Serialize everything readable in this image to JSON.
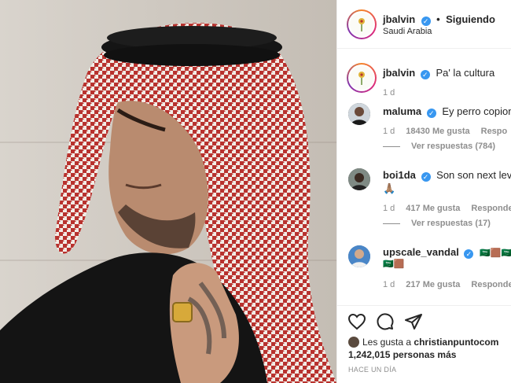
{
  "post": {
    "author": "jbalvin",
    "follow_status": "Siguiendo",
    "location": "Saudi Arabia",
    "caption": "Pa' la cultura",
    "caption_age": "1 d"
  },
  "comments": [
    {
      "user": "maluma",
      "text": "Ey perro copion",
      "age": "1 d",
      "likes": "18430 Me gusta",
      "reply": "Respo",
      "replies": "Ver respuestas (784)"
    },
    {
      "user": "boi1da",
      "text": "Son son next level",
      "text2": "🙏🏽",
      "age": "1 d",
      "likes": "417 Me gusta",
      "reply": "Responde",
      "replies": "Ver respuestas (17)"
    },
    {
      "user": "upscale_vandal",
      "text": "🇸🇦🟫🇸🇦🟫",
      "text2": "🇸🇦🟫",
      "age": "1 d",
      "likes": "217 Me gusta",
      "reply": "Responde"
    }
  ],
  "footer": {
    "likes_prefix": "Les gusta a",
    "liker": "christianpuntocom",
    "likes_count": "1,242,015 personas más",
    "timestamp": "HACE UN DÍA"
  },
  "icons": {
    "verified": "verified-badge-icon",
    "like": "heart-icon",
    "comment": "comment-bubble-icon",
    "share": "paper-plane-icon"
  },
  "colors": {
    "verified": "#3897f0",
    "meta": "#8e8e8e",
    "text": "#262626"
  }
}
